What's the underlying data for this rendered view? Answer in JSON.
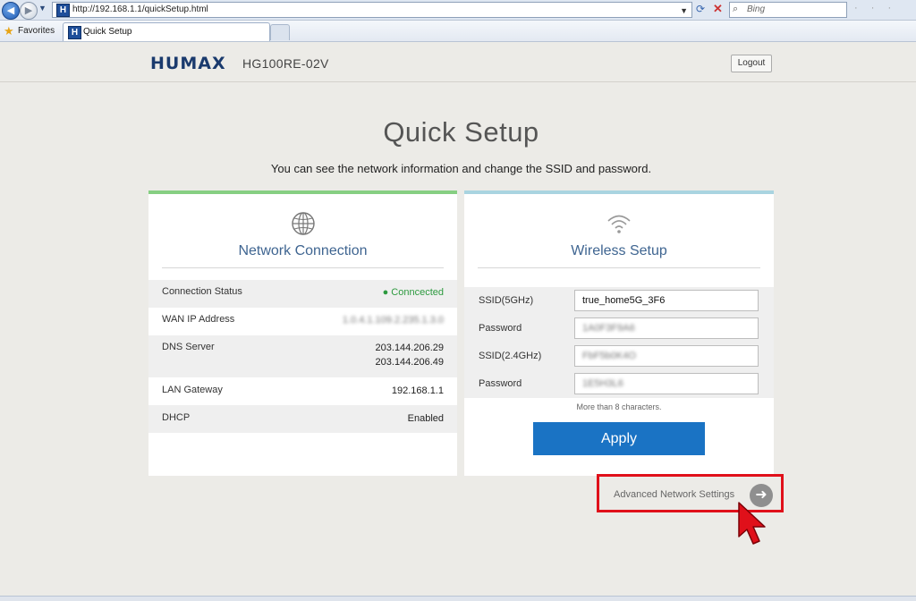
{
  "browser": {
    "url": "http://192.168.1.1/quickSetup.html",
    "search_placeholder": "Bing",
    "favorites_label": "Favorites",
    "tab_title": "Quick Setup",
    "favicon_letter": "H"
  },
  "header": {
    "brand": "HUMAX",
    "model": "HG100RE-02V",
    "logout_label": "Logout"
  },
  "page": {
    "title": "Quick Setup",
    "subtitle": "You can see the network information and change the SSID and password."
  },
  "network": {
    "title": "Network Connection",
    "icon": "globe-icon",
    "rows": [
      {
        "label": "Connection Status",
        "value": "Conncected",
        "status_color": "#2d9a3f"
      },
      {
        "label": "WAN IP Address",
        "value": "1.0.4.1.109.2.235.1.3.0"
      },
      {
        "label": "DNS Server",
        "value": "203.144.206.29",
        "value2": "203.144.206.49"
      },
      {
        "label": "LAN Gateway",
        "value": "192.168.1.1"
      },
      {
        "label": "DHCP",
        "value": "Enabled"
      }
    ]
  },
  "wireless": {
    "title": "Wireless Setup",
    "icon": "wifi-icon",
    "fields": [
      {
        "label": "SSID(5GHz)",
        "value": "true_home5G_3F6"
      },
      {
        "label": "Password",
        "value": "1A0F3F9A6"
      },
      {
        "label": "SSID(2.4GHz)",
        "value": "FbF5b0K4O"
      },
      {
        "label": "Password",
        "value": "1E5H3L6"
      }
    ],
    "hint": "More than 8 characters.",
    "apply_label": "Apply"
  },
  "advanced": {
    "label": "Advanced Network Settings",
    "highlight_color": "#e0101a"
  },
  "colors": {
    "accent_blue": "#1a73c4",
    "network_bar": "#86cf82",
    "wireless_bar": "#a9d4e0",
    "brand": "#1a3a6d"
  }
}
